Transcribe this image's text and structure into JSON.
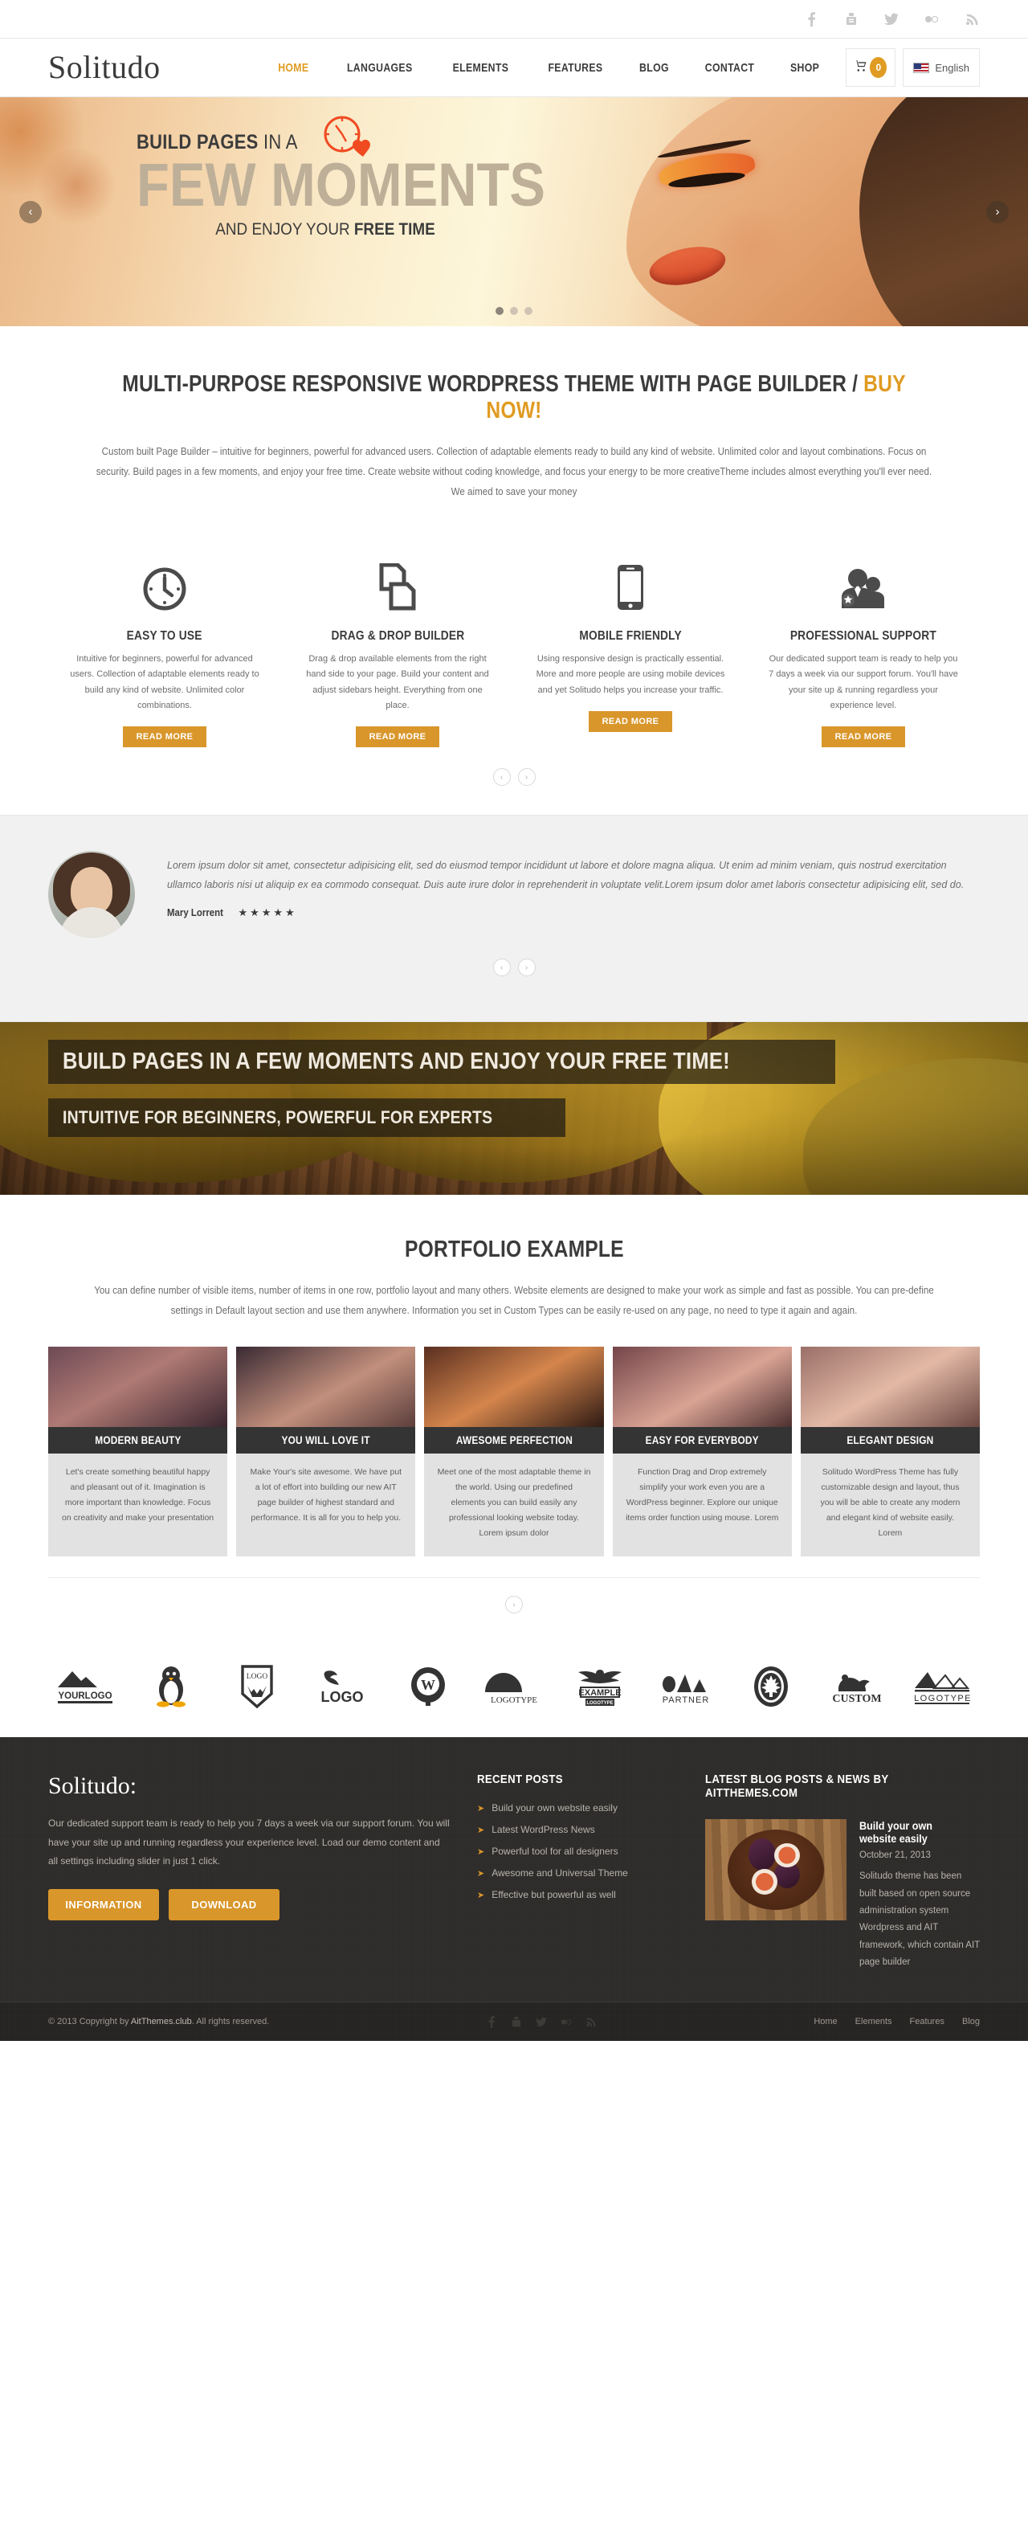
{
  "brand": {
    "name": "Solitudo",
    "accent": "#e09b22",
    "button": "#d9962a",
    "dark": "#2e2c2a"
  },
  "topbar": {
    "social": [
      {
        "name": "facebook-icon",
        "label": "Facebook"
      },
      {
        "name": "youtube-icon",
        "label": "YouTube"
      },
      {
        "name": "twitter-icon",
        "label": "Twitter"
      },
      {
        "name": "flickr-icon",
        "label": "Flickr"
      },
      {
        "name": "rss-icon",
        "label": "RSS"
      }
    ]
  },
  "header": {
    "logo": "Solitudo",
    "nav": [
      {
        "label": "HOME",
        "active": true
      },
      {
        "label": "LANGUAGES",
        "active": false
      },
      {
        "label": "ELEMENTS",
        "active": false
      },
      {
        "label": "FEATURES",
        "active": false
      },
      {
        "label": "BLOG",
        "active": false
      },
      {
        "label": "CONTACT",
        "active": false
      },
      {
        "label": "SHOP",
        "active": false
      }
    ],
    "cart_count": "0",
    "language": "English"
  },
  "slider": {
    "line1_bold": "BUILD PAGES",
    "line1_rest": " IN A",
    "line2": "FEW MOMENTS",
    "line3_rest": "AND ENJOY YOUR ",
    "line3_bold": "FREE TIME",
    "prev": "‹",
    "next": "›",
    "dots": 3,
    "active_dot": 0
  },
  "intro": {
    "title_main": "MULTI-PURPOSE RESPONSIVE WORDPRESS THEME WITH PAGE BUILDER / ",
    "title_highlight": "BUY NOW!",
    "paragraph": "Custom built Page Builder – intuitive for beginners, powerful for advanced users. Collection of adaptable elements ready to build any kind of website. Unlimited color and layout combinations. Focus on security. Build pages in a few moments, and enjoy your free time. Create website without coding knowledge, and focus your energy to be more creativeTheme includes almost everything you'll ever need. We aimed to save your money"
  },
  "features": {
    "items": [
      {
        "icon": "clock-icon",
        "title": "EASY TO USE",
        "text": "Intuitive for beginners, powerful for advanced users. Collection of adaptable elements ready to build any kind of website. Unlimited color combinations.",
        "button": "READ MORE"
      },
      {
        "icon": "pages-icon",
        "title": "DRAG & DROP BUILDER",
        "text": "Drag & drop available elements from the right hand side to your page. Build your content and adjust sidebars height. Everything from one place.",
        "button": "READ MORE"
      },
      {
        "icon": "mobile-icon",
        "title": "MOBILE FRIENDLY",
        "text": "Using responsive design is practically essential. More and more people are using mobile devices and yet Solitudo helps you increase your traffic.",
        "button": "READ MORE"
      },
      {
        "icon": "support-team-icon",
        "title": "PROFESSIONAL SUPPORT",
        "text": "Our dedicated support team is ready to help you 7 days a week via our support forum. You'll have your site up & running regardless your experience level.",
        "button": "READ MORE"
      }
    ],
    "prev": "‹",
    "next": "›"
  },
  "testimonial": {
    "quote": "Lorem ipsum dolor sit amet, consectetur adipisicing elit, sed do eiusmod tempor incididunt ut labore et dolore magna aliqua. Ut enim ad minim veniam, quis nostrud exercitation ullamco laboris nisi ut aliquip ex ea commodo consequat. Duis aute irure dolor in reprehenderit in voluptate velit.Lorem ipsum dolor amet laboris consectetur adipisicing elit, sed do.",
    "author": "Mary Lorrent",
    "rating": "★★★★★",
    "prev": "‹",
    "next": "›"
  },
  "banner": {
    "line1": "BUILD PAGES IN A FEW MOMENTS AND ENJOY YOUR FREE TIME!",
    "line2": "INTUITIVE FOR BEGINNERS, POWERFUL FOR EXPERTS"
  },
  "portfolio": {
    "title": "PORTFOLIO EXAMPLE",
    "lead": "You can define number of visible items, number of items in one row, portfolio layout and many others. Website elements are designed to make your work as simple and fast as possible. You can pre-define settings in Default layout section and use them anywhere. Information you set in Custom Types can be easily re-used on any page, no need to type it again and again.",
    "cards": [
      {
        "title": "MODERN BEAUTY",
        "text": "Let's create something beautiful happy and pleasant out of it. Imagination is more important than knowledge. Focus on creativity and make your presentation"
      },
      {
        "title": "YOU WILL LOVE IT",
        "text": "Make Your's site awesome. We have put a lot of effort into building our new AIT page builder of highest standard and performance. It is all for you to help you."
      },
      {
        "title": "AWESOME PERFECTION",
        "text": "Meet one of the most adaptable theme in the world. Using our predefined elements you can build easily any professional looking website today. Lorem ipsum dolor"
      },
      {
        "title": "EASY FOR EVERYBODY",
        "text": "Function Drag and Drop extremely simplify your work even you are a WordPress beginner. Explore our unique items order function using mouse. Lorem"
      },
      {
        "title": "ELEGANT DESIGN",
        "text": "Solitudo WordPress Theme has fully customizable design and layout, thus you will be able to create any modern and elegant kind of website easily. Lorem"
      }
    ],
    "more": "›"
  },
  "logos": [
    {
      "name": "yourlogo-mountain-logo",
      "label": "YOURLOGO"
    },
    {
      "name": "penguin-logo",
      "label": ""
    },
    {
      "name": "logo-shield-logo",
      "label": "LOGO"
    },
    {
      "name": "logo-bird-logo",
      "label": "LOGO"
    },
    {
      "name": "w-wreath-logo",
      "label": "W"
    },
    {
      "name": "logotype-bear-logo",
      "label": "LOGOTYPE"
    },
    {
      "name": "example-eagle-logo",
      "label": "EXAMPLE"
    },
    {
      "name": "partner-logo",
      "label": "PARTNER"
    },
    {
      "name": "maple-leaf-seal-logo",
      "label": ""
    },
    {
      "name": "custom-bear-logo",
      "label": "CUSTOM"
    },
    {
      "name": "logotype-mountains-logo",
      "label": "LOGOTYPE"
    }
  ],
  "footer": {
    "col1": {
      "title": "Solitudo:",
      "text": "Our dedicated support team is ready to help you 7 days a week via our support forum. You will have your site up and running regardless your experience level. Load our demo content and all settings including slider in just 1 click.",
      "btn1": "INFORMATION",
      "btn2": "DOWNLOAD"
    },
    "col2": {
      "title": "RECENT POSTS",
      "items": [
        "Build your own website easily",
        "Latest WordPress News",
        "Powerful tool for all designers",
        "Awesome and Universal Theme",
        "Effective but powerful as well"
      ]
    },
    "col3": {
      "title": "LATEST BLOG POSTS & NEWS BY AITTHEMES.COM",
      "post_title": "Build your own website easily",
      "post_date": "October 21, 2013",
      "post_excerpt": "Solitudo theme has been built based on open source administration system Wordpress and AIT framework, which contain AIT page builder"
    }
  },
  "copyright": {
    "text_prefix": "© 2013 Copyright by ",
    "link": "AitThemes.club",
    "text_suffix": ". All rights reserved.",
    "nav": [
      "Home",
      "Elements",
      "Features",
      "Blog"
    ]
  }
}
